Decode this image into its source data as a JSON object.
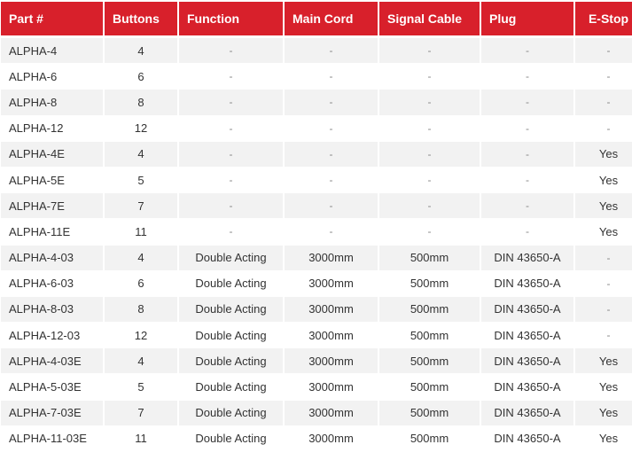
{
  "headers": [
    "Part #",
    "Buttons",
    "Function",
    "Main Cord",
    "Signal Cable",
    "Plug",
    "E-Stop"
  ],
  "rows": [
    [
      "ALPHA-4",
      "4",
      "-",
      "-",
      "-",
      "-",
      "-"
    ],
    [
      "ALPHA-6",
      "6",
      "-",
      "-",
      "-",
      "-",
      "-"
    ],
    [
      "ALPHA-8",
      "8",
      "-",
      "-",
      "-",
      "-",
      "-"
    ],
    [
      "ALPHA-12",
      "12",
      "-",
      "-",
      "-",
      "-",
      "-"
    ],
    [
      "ALPHA-4E",
      "4",
      "-",
      "-",
      "-",
      "-",
      "Yes"
    ],
    [
      "ALPHA-5E",
      "5",
      "-",
      "-",
      "-",
      "-",
      "Yes"
    ],
    [
      "ALPHA-7E",
      "7",
      "-",
      "-",
      "-",
      "-",
      "Yes"
    ],
    [
      "ALPHA-11E",
      "11",
      "-",
      "-",
      "-",
      "-",
      "Yes"
    ],
    [
      "ALPHA-4-03",
      "4",
      "Double Acting",
      "3000mm",
      "500mm",
      "DIN 43650-A",
      "-"
    ],
    [
      "ALPHA-6-03",
      "6",
      "Double Acting",
      "3000mm",
      "500mm",
      "DIN 43650-A",
      "-"
    ],
    [
      "ALPHA-8-03",
      "8",
      "Double Acting",
      "3000mm",
      "500mm",
      "DIN 43650-A",
      "-"
    ],
    [
      "ALPHA-12-03",
      "12",
      "Double Acting",
      "3000mm",
      "500mm",
      "DIN 43650-A",
      "-"
    ],
    [
      "ALPHA-4-03E",
      "4",
      "Double Acting",
      "3000mm",
      "500mm",
      "DIN 43650-A",
      "Yes"
    ],
    [
      "ALPHA-5-03E",
      "5",
      "Double Acting",
      "3000mm",
      "500mm",
      "DIN 43650-A",
      "Yes"
    ],
    [
      "ALPHA-7-03E",
      "7",
      "Double Acting",
      "3000mm",
      "500mm",
      "DIN 43650-A",
      "Yes"
    ],
    [
      "ALPHA-11-03E",
      "11",
      "Double Acting",
      "3000mm",
      "500mm",
      "DIN 43650-A",
      "Yes"
    ]
  ],
  "colors": {
    "header_bg": "#d8202b",
    "header_text": "#ffffff",
    "stripe": "#f2f2f2"
  }
}
